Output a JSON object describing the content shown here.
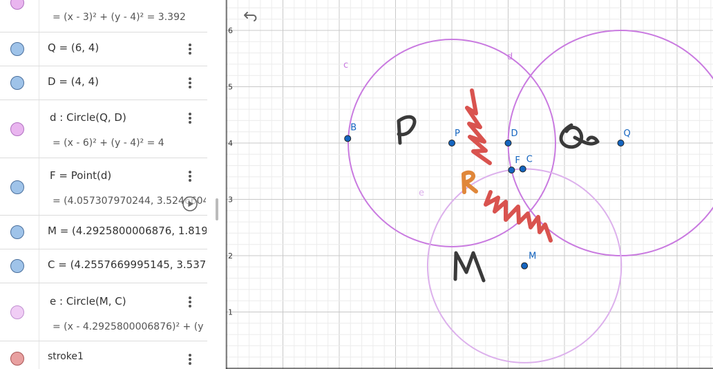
{
  "algebra": {
    "top_partial_value": "= (x - 3)² + (y - 4)² = 3.392",
    "rows": [
      {
        "def": "Q = (6, 4)",
        "color": "#9fc3e9"
      },
      {
        "def": "D = (4, 4)",
        "color": "#9fc3e9"
      },
      {
        "def": "d : Circle(Q, D)",
        "value": "= (x - 6)² + (y - 4)² = 4",
        "color": "#e9b5ef"
      },
      {
        "def": "F = Point(d)",
        "value": "= (4.057307970244, 3.524660460",
        "color": "#9fc3e9"
      },
      {
        "def": "M = (4.2925800006876, 1.819472",
        "color": "#9fc3e9"
      },
      {
        "def": "C = (4.2557669995145, 3.537124",
        "color": "#9fc3e9"
      },
      {
        "def": "e : Circle(M, C)",
        "value": "= (x - 4.2925800006876)² + (y -",
        "color": "#f0cdf5"
      },
      {
        "def": "stroke1",
        "color": "#e8a0a0"
      }
    ]
  },
  "graphics": {
    "y_ticks": [
      "6",
      "5",
      "4",
      "3",
      "2",
      "1"
    ],
    "circle_labels": {
      "c": "c",
      "d": "d",
      "e": "e"
    },
    "points": {
      "B": {
        "label": "B",
        "x": 2.15,
        "y": 4.08
      },
      "P": {
        "label": "P",
        "x": 4.0,
        "y": 4.0
      },
      "D": {
        "label": "D",
        "x": 5.0,
        "y": 4.0
      },
      "Q": {
        "label": "Q",
        "x": 7.0,
        "y": 4.0
      },
      "F": {
        "label": "F",
        "x": 5.06,
        "y": 3.52
      },
      "C": {
        "label": "C",
        "x": 5.26,
        "y": 3.54
      },
      "M": {
        "label": "M",
        "x": 5.29,
        "y": 1.82
      }
    },
    "circles": [
      {
        "name": "c",
        "cx": 4.0,
        "cy": 4.0,
        "r": 1.84,
        "color": "#c97ae0"
      },
      {
        "name": "d",
        "cx": 7.0,
        "cy": 4.0,
        "r": 2.0,
        "color": "#c97ae0"
      },
      {
        "name": "e",
        "cx": 5.29,
        "cy": 1.82,
        "r": 1.72,
        "color": "#dcb0ec"
      }
    ],
    "colors": {
      "point": "#1565c0",
      "ink_dark": "#3a3a3a",
      "ink_red": "#d9534f",
      "ink_orange": "#e0873a"
    }
  },
  "icons": {
    "undo": "undo-icon",
    "play": "play-icon",
    "menu": "more-vert-icon"
  }
}
